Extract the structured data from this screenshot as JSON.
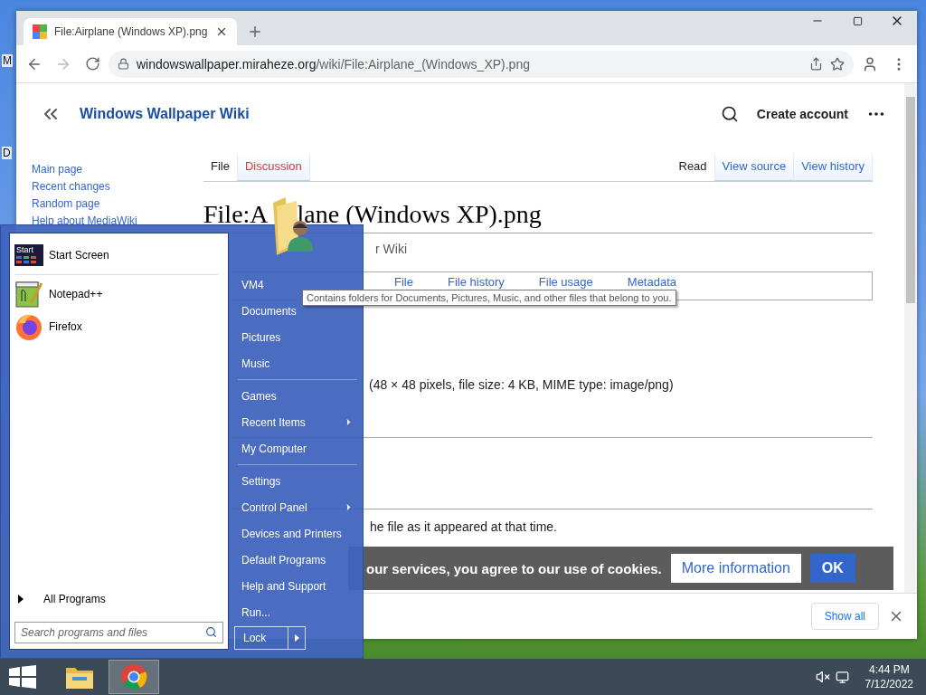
{
  "desktop": {
    "icon_labels": [
      "M",
      "D"
    ]
  },
  "browser": {
    "tab": {
      "title": "File:Airplane (Windows XP).png"
    },
    "url": {
      "domain": "windowswallpaper.miraheze.org",
      "path": "/wiki/File:Airplane_(Windows_XP).png"
    },
    "forward_disabled": true
  },
  "wiki": {
    "site_name": "Windows Wallpaper Wiki",
    "create_account": "Create account",
    "sidebar": [
      "Main page",
      "Recent changes",
      "Random page",
      "Help about MediaWiki"
    ],
    "tabs_left": [
      {
        "label": "File",
        "selected": true,
        "missing": false
      },
      {
        "label": "Discussion",
        "selected": false,
        "missing": true
      }
    ],
    "tabs_right": [
      {
        "label": "Read",
        "selected": true
      },
      {
        "label": "View source",
        "selected": false
      },
      {
        "label": "View history",
        "selected": false
      }
    ],
    "title_parts": [
      "File:A",
      "lane (Windows XP).png"
    ],
    "subtitle": "r Wiki",
    "file_tabs": [
      "File",
      "File history",
      "File usage",
      "Metadata"
    ],
    "file_info": "(48 × 48 pixels, file size: 4 KB, MIME type: image/png)",
    "history_note": "he file as it appeared at that time.",
    "cookie": {
      "text": "our services, you agree to our use of cookies.",
      "more": "More information",
      "ok": "OK"
    }
  },
  "downloads": {
    "show_all": "Show all"
  },
  "start_menu": {
    "pinned": [
      {
        "kind": "start-screen",
        "label": "Start Screen",
        "badge": "Start"
      }
    ],
    "recent": [
      {
        "kind": "notepad",
        "label": "Notepad++"
      },
      {
        "kind": "firefox",
        "label": "Firefox"
      }
    ],
    "all_programs": "All Programs",
    "search_placeholder": "Search programs and files",
    "places": [
      {
        "kind": "item",
        "label": "VM4",
        "submenu": false
      },
      {
        "kind": "item",
        "label": "Documents",
        "submenu": false
      },
      {
        "kind": "item",
        "label": "Pictures",
        "submenu": false
      },
      {
        "kind": "item",
        "label": "Music",
        "submenu": false
      },
      {
        "kind": "divider"
      },
      {
        "kind": "item",
        "label": "Games",
        "submenu": false
      },
      {
        "kind": "item",
        "label": "Recent Items",
        "submenu": true
      },
      {
        "kind": "item",
        "label": "My Computer",
        "submenu": false
      },
      {
        "kind": "divider"
      },
      {
        "kind": "item",
        "label": "Settings",
        "submenu": false
      },
      {
        "kind": "item",
        "label": "Control Panel",
        "submenu": true
      },
      {
        "kind": "item",
        "label": "Devices and Printers",
        "submenu": false
      },
      {
        "kind": "item",
        "label": "Default Programs",
        "submenu": false
      },
      {
        "kind": "item",
        "label": "Help and Support",
        "submenu": false
      },
      {
        "kind": "item",
        "label": "Run...",
        "submenu": false
      }
    ],
    "lock": "Lock",
    "tooltip": "Contains folders for Documents, Pictures, Music, and other files that belong to you."
  },
  "taskbar": {
    "apps": [
      {
        "kind": "explorer",
        "selected": false
      },
      {
        "kind": "chrome",
        "selected": true
      }
    ],
    "muted": true,
    "time": "4:44 PM",
    "date": "7/12/2022"
  }
}
